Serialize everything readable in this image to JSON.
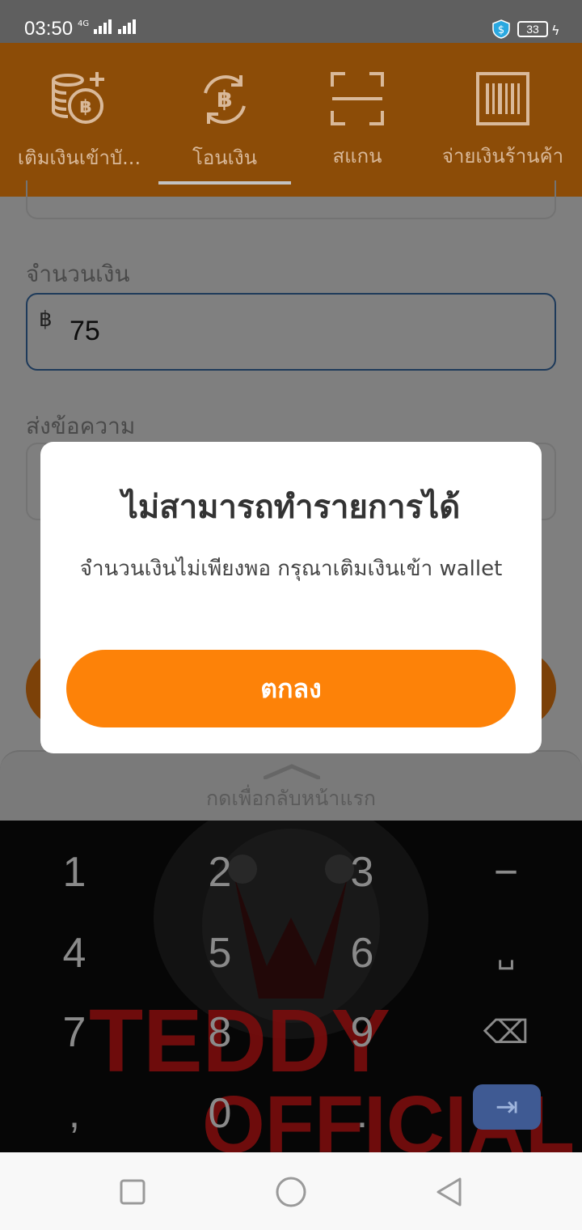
{
  "status_bar": {
    "time": "03:50",
    "network": "4G",
    "battery": "33",
    "colors": {
      "background": "#5f5f5f"
    }
  },
  "top_nav": {
    "tabs": [
      {
        "label": "เติมเงินเข้าบั...",
        "icon": "coins-plus-icon"
      },
      {
        "label": "โอนเงิน",
        "icon": "baht-transfer-icon",
        "active": true
      },
      {
        "label": "สแกน",
        "icon": "scan-frame-icon"
      },
      {
        "label": "จ่ายเงินร้านค้า",
        "icon": "barcode-icon"
      }
    ],
    "colors": {
      "background": "#8c4c07",
      "text": "#d9b99a"
    }
  },
  "form": {
    "amount_label": "จำนวนเงิน",
    "currency_symbol": "฿",
    "amount_value": "75",
    "message_label": "ส่งข้อความ",
    "home_label": "กดเพื่อกลับหน้าแรก"
  },
  "dialog": {
    "title": "ไม่สามารถทำรายการได้",
    "message": "จำนวนเงินไม่เพียงพอ กรุณาเติมเงินเข้า wallet",
    "ok_label": "ตกลง",
    "colors": {
      "button": "#fd8208"
    }
  },
  "keyboard": {
    "keys": [
      "1",
      "2",
      "3",
      "−",
      "4",
      "5",
      "6",
      "␣",
      "7",
      "8",
      "9",
      "⌫",
      ",",
      "0",
      ".",
      "⇥"
    ],
    "theme_text": [
      "TEDDY",
      "OFFICIAL"
    ]
  },
  "nav_bar": {
    "buttons": [
      "recents-square-icon",
      "home-circle-icon",
      "back-triangle-icon"
    ]
  }
}
